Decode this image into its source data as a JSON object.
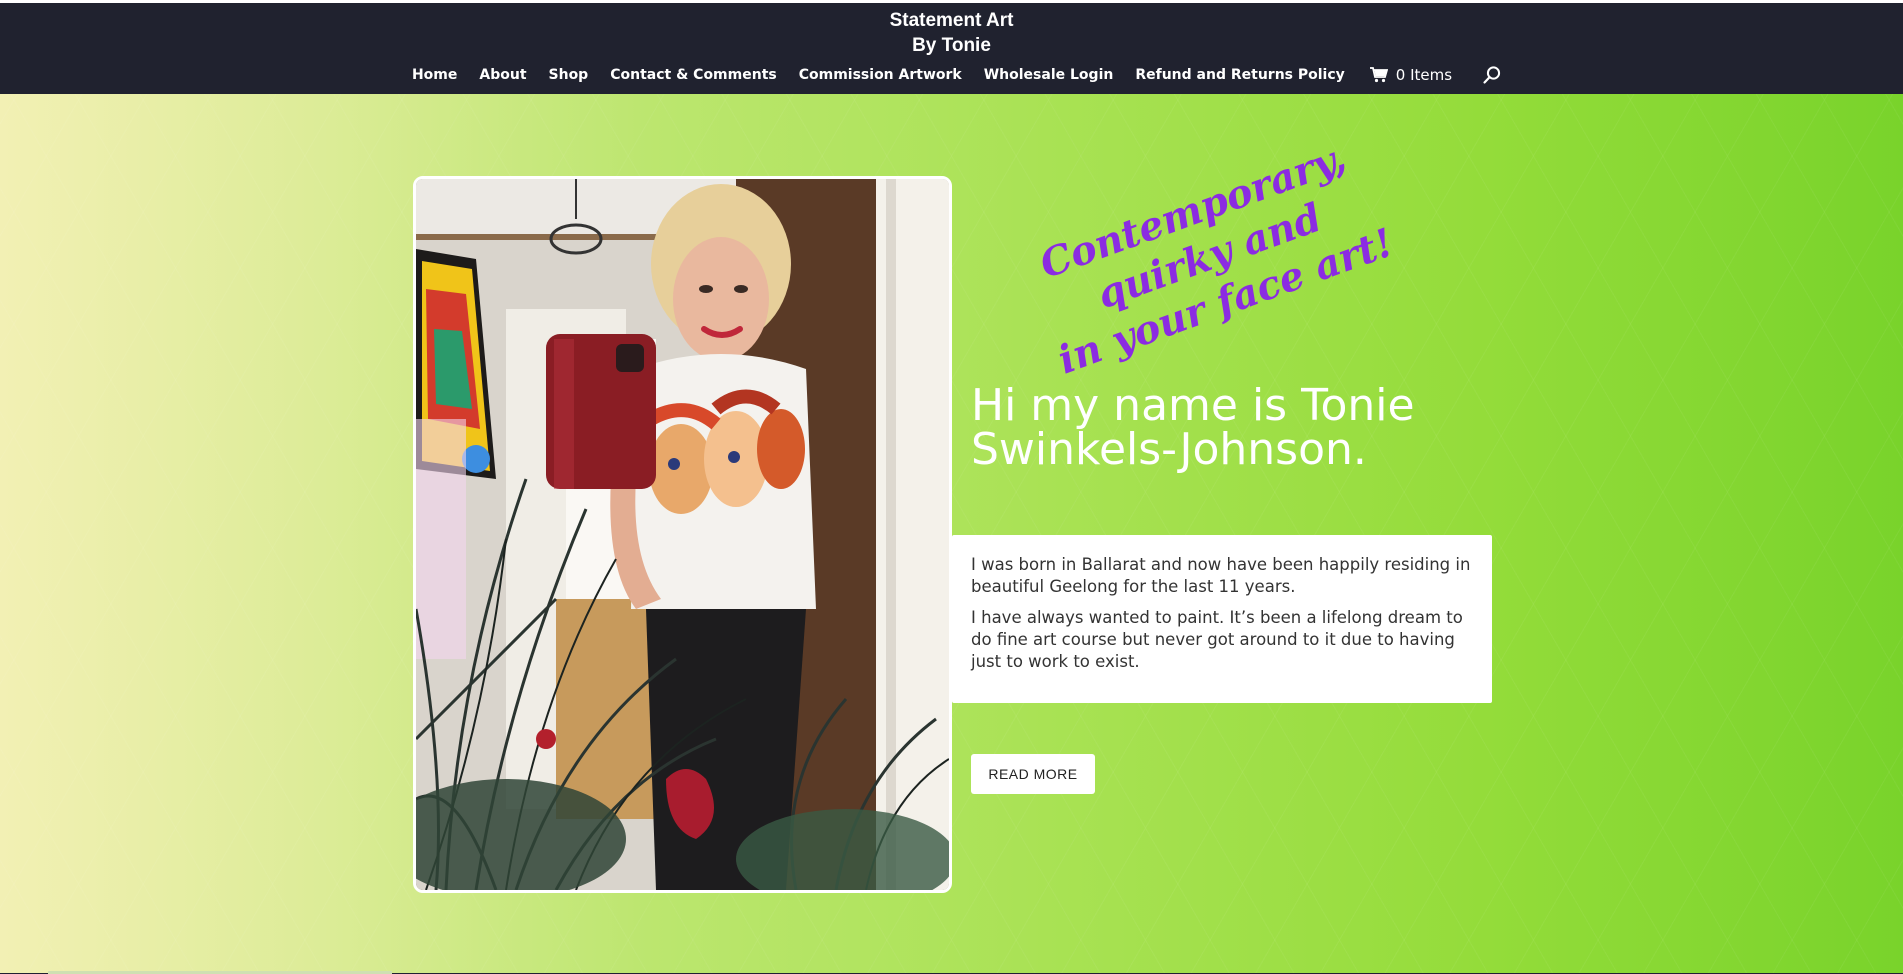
{
  "site": {
    "title_line1": "Statement Art",
    "title_line2": "By Tonie"
  },
  "nav": {
    "items": [
      {
        "label": "Home"
      },
      {
        "label": "About"
      },
      {
        "label": "Shop"
      },
      {
        "label": "Contact & Comments"
      },
      {
        "label": "Commission Artwork"
      },
      {
        "label": "Wholesale Login"
      },
      {
        "label": "Refund and Returns Policy"
      }
    ],
    "cart_label": "0 Items",
    "cart_icon": "shopping-cart-icon",
    "search_icon": "search-icon"
  },
  "hero": {
    "tagline_line1": "Contemporary, quirky and",
    "tagline_line2": "in your face art!",
    "heading": "Hi my name is Tonie Swinkels-Johnson.",
    "bio_paragraph1": "I was born in Ballarat and now have been happily residing in beautiful Geelong for the last 11 years.",
    "bio_paragraph2": "I have always wanted to paint. It’s been a lifelong dream to do fine art course but never got around to it due to having just to work to exist.",
    "button_label": "READ MORE"
  },
  "colors": {
    "header_bg": "#20222f",
    "tagline": "#8b2be2",
    "hero_gradient_start": "#f2f0b4",
    "hero_gradient_end": "#79d32b"
  }
}
